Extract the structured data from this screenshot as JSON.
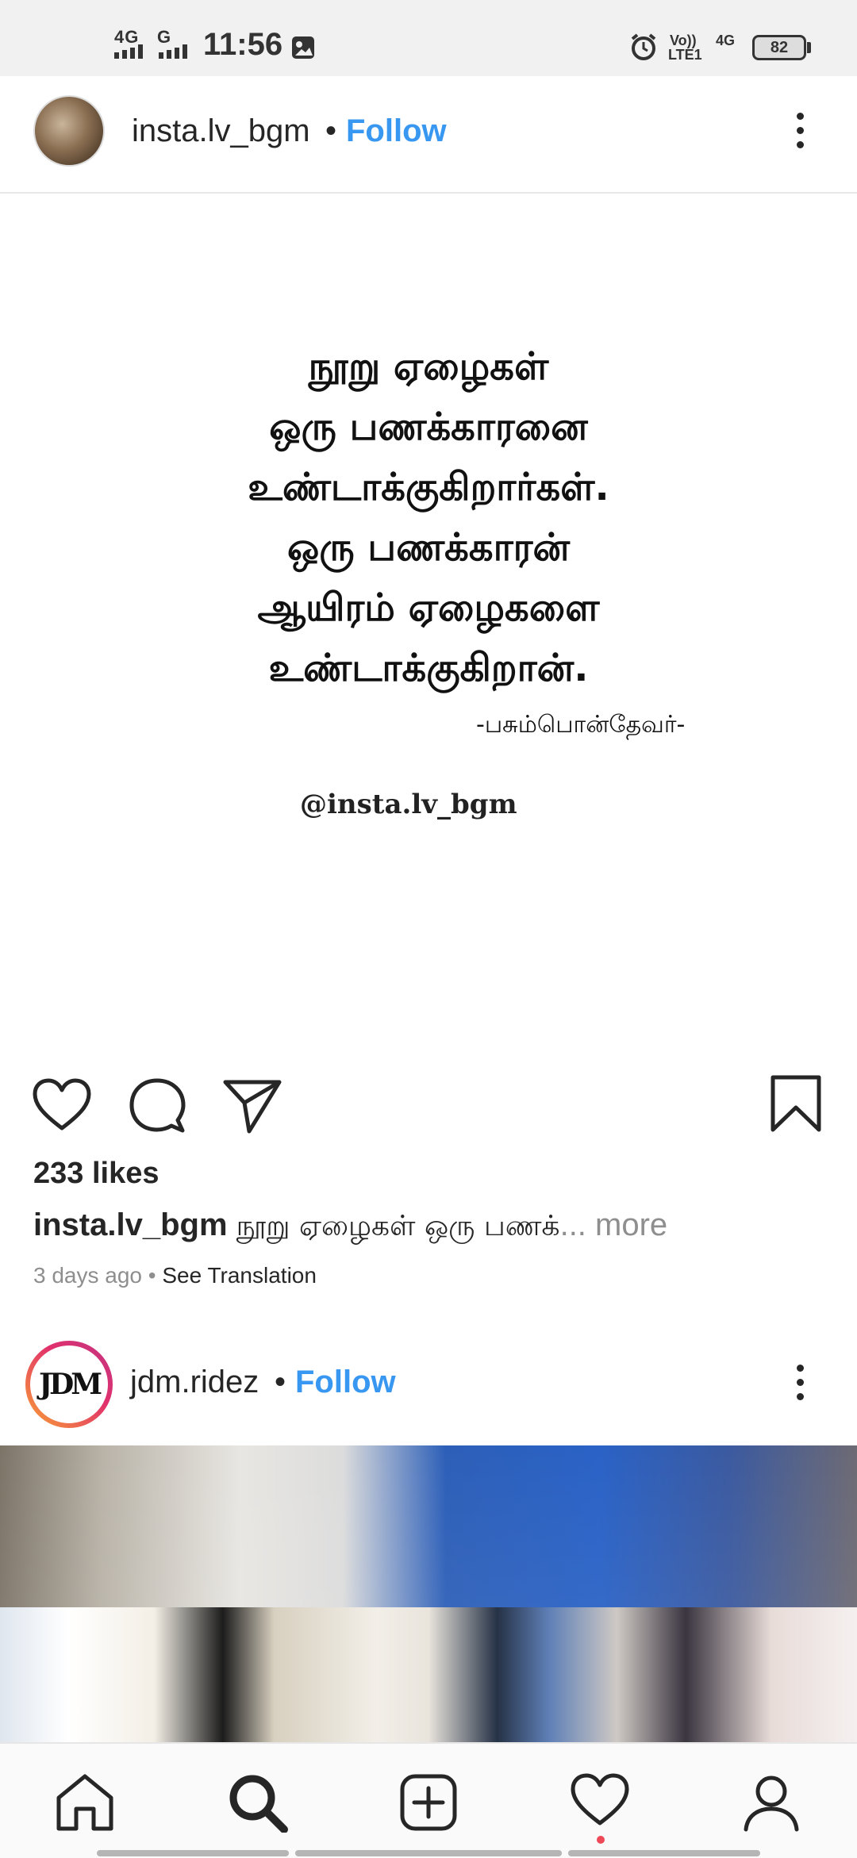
{
  "status_bar": {
    "network1": "4G",
    "network2": "G",
    "time": "11:56",
    "volte": "Vo))",
    "lte": "LTE1",
    "network3": "4G",
    "battery": "82"
  },
  "post1": {
    "username": "insta.lv_bgm",
    "separator": "•",
    "follow_label": "Follow",
    "quote_lines": [
      "நூறு  ஏழைகள்",
      "ஒரு  பணக்காரனை",
      "உண்டாக்குகிறார்கள்.",
      "ஒரு  பணக்காரன்",
      "ஆயிரம்  ஏழைகளை",
      "உண்டாக்குகிறான்."
    ],
    "quote_author": "-பசும்பொன்தேவர்-",
    "watermark": "@insta.lv_bgm",
    "likes": "233 likes",
    "caption_user": "insta.lv_bgm",
    "caption_text": "நூறு ஏழைகள் ஒரு பணக்",
    "caption_ellipsis": "... more",
    "time_ago": "3 days ago",
    "meta_dot": " • ",
    "see_translation": "See Translation"
  },
  "post2": {
    "avatar_text": "JDM",
    "username": "jdm.ridez",
    "separator": "•",
    "follow_label": "Follow"
  },
  "icons": {
    "like": "heart-icon",
    "comment": "comment-icon",
    "share": "send-icon",
    "save": "bookmark-icon",
    "nav": [
      "home-icon",
      "search-icon",
      "add-post-icon",
      "activity-heart-icon",
      "profile-icon"
    ]
  },
  "colors": {
    "follow_blue": "#3897f0",
    "notification_red": "#ed4956"
  }
}
